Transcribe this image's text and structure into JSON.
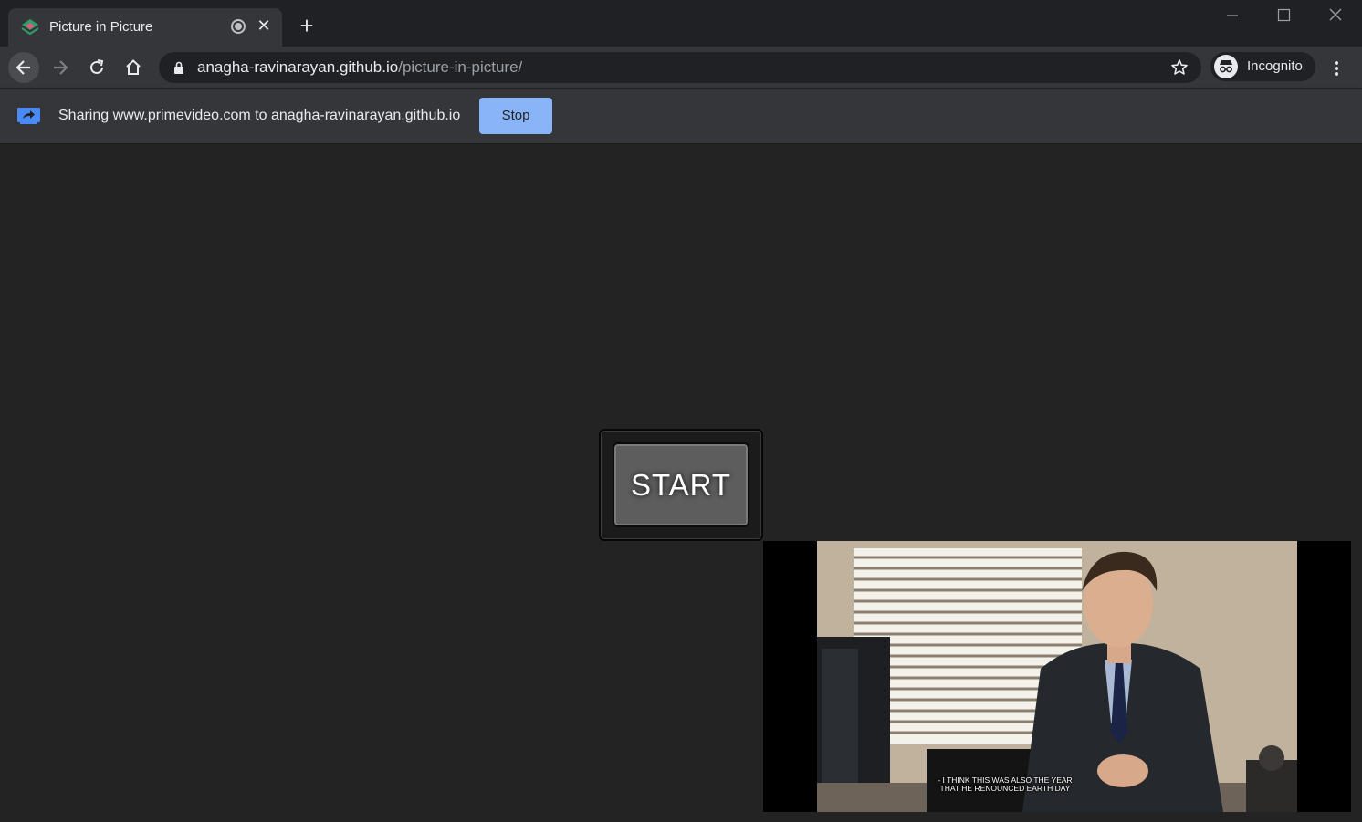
{
  "window": {
    "tab_title": "Picture in Picture",
    "new_tab_symbol": "+",
    "tab_close_symbol": "✕"
  },
  "toolbar": {
    "url_host": "anagha-ravinarayan.github.io",
    "url_path": "/picture-in-picture/",
    "profile_label": "Incognito"
  },
  "infobar": {
    "message": "Sharing www.primevideo.com to anagha-ravinarayan.github.io",
    "stop_label": "Stop"
  },
  "main": {
    "start_label": "START"
  },
  "pip": {
    "subtitle_line1": "- I THINK THIS WAS ALSO THE YEAR",
    "subtitle_line2": "THAT HE RENOUNCED EARTH DAY"
  },
  "colors": {
    "accent": "#8ab4f8",
    "titlebar": "#202124",
    "toolbar": "#35363a",
    "page_bg": "#232323"
  },
  "icons": [
    "favicon-icon",
    "media-playing-icon",
    "close-icon",
    "plus-icon",
    "minimize-icon",
    "maximize-icon",
    "window-close-icon",
    "back-icon",
    "forward-icon",
    "reload-icon",
    "home-icon",
    "lock-icon",
    "star-icon",
    "incognito-icon",
    "more-vert-icon",
    "screen-share-icon"
  ]
}
